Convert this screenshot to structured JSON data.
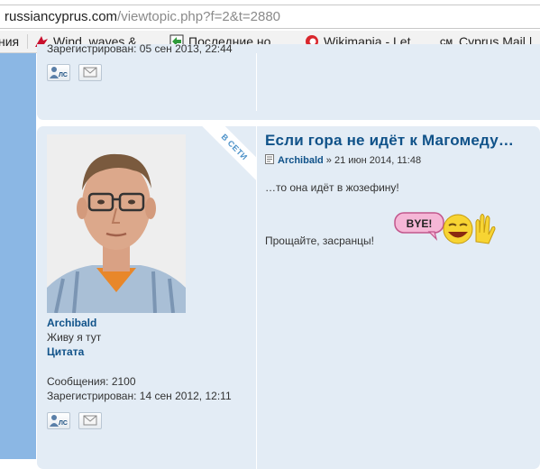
{
  "browser": {
    "url_host": "russiancyprus.com",
    "url_path": "/viewtopic.php?f=2&t=2880",
    "bookmarks": [
      {
        "label": "ния",
        "icon": "none"
      },
      {
        "label": "Wind, waves & ...",
        "icon": "windfinder-icon"
      },
      {
        "label": "Последние но...",
        "icon": "green-arrow-icon"
      },
      {
        "label": "Wikimapia - Let...",
        "icon": "wikimapia-icon"
      },
      {
        "label": "Cyprus Mail |",
        "icon": "cyprus-mail-icon"
      }
    ]
  },
  "prev_post": {
    "registered": "Зарегистрирован: 05 сен 2013, 22:44"
  },
  "post": {
    "online_badge": "В СЕТИ",
    "username": "Archibald",
    "rank": "Живу я тут",
    "quote_label": "Цитата",
    "messages_label": "Сообщения:",
    "messages_value": "2100",
    "registered_label": "Зарегистрирован:",
    "registered_value": "14 сен 2012, 12:11",
    "title": "Если гора не идёт к Магомеду…",
    "meta_author": "Archibald",
    "meta_sep": "»",
    "meta_date": "21 июн 2014, 11:48",
    "body_line1": "…то она идёт в жозефину!",
    "body_line2": "Прощайте, засранцы!",
    "smiley_text": "BYE!"
  },
  "colors": {
    "link": "#105289",
    "post_bg": "#e3ecf5",
    "page_bg": "#8bb7e4"
  }
}
